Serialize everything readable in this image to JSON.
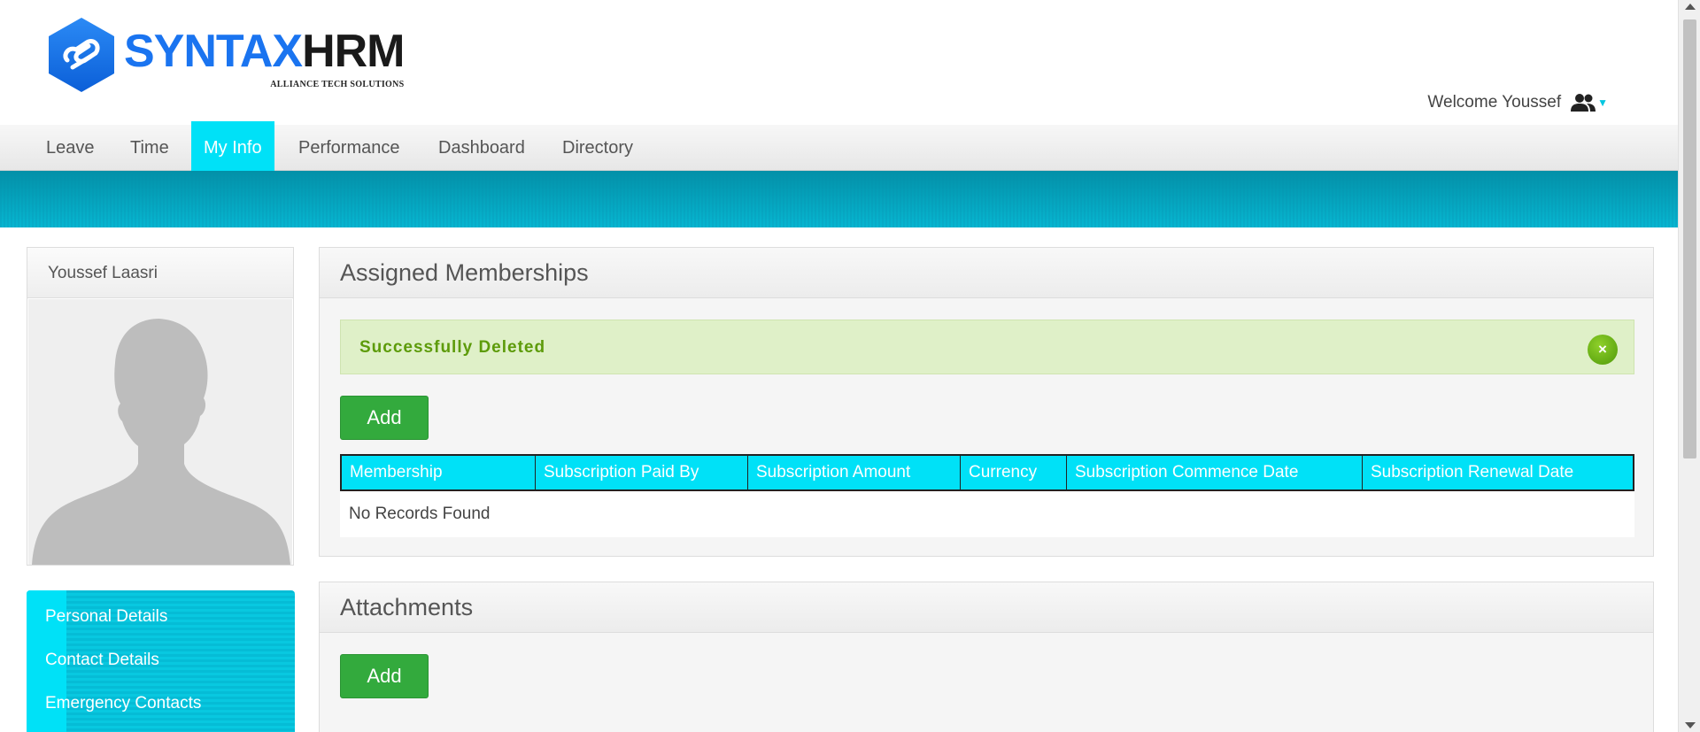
{
  "header": {
    "logo_word_left": "SYNTAX",
    "logo_word_right": "HRM",
    "logo_subtitle": "ALLIANCE TECH SOLUTIONS",
    "welcome_text": "Welcome Youssef",
    "user_icon": "users-icon",
    "dropdown_icon": "caret-down-icon"
  },
  "nav": {
    "items": [
      {
        "label": "Leave",
        "active": false
      },
      {
        "label": "Time",
        "active": false
      },
      {
        "label": "My Info",
        "active": true
      },
      {
        "label": "Performance",
        "active": false
      },
      {
        "label": "Dashboard",
        "active": false
      },
      {
        "label": "Directory",
        "active": false
      }
    ]
  },
  "profile": {
    "name": "Youssef Laasri",
    "photo_icon": "avatar-placeholder-icon"
  },
  "side_menu": {
    "items": [
      {
        "label": "Personal Details"
      },
      {
        "label": "Contact Details"
      },
      {
        "label": "Emergency Contacts"
      }
    ]
  },
  "memberships": {
    "title": "Assigned Memberships",
    "alert": "Successfully Deleted",
    "alert_close": "×",
    "add_label": "Add",
    "columns": [
      "Membership",
      "Subscription Paid By",
      "Subscription Amount",
      "Currency",
      "Subscription Commence Date",
      "Subscription Renewal Date"
    ],
    "empty_text": "No Records Found"
  },
  "attachments": {
    "title": "Attachments",
    "add_label": "Add"
  },
  "colors": {
    "accent_cyan": "#00e1f7",
    "button_green": "#33aa3d",
    "alert_bg": "#dff0c8",
    "alert_text": "#5d9b0a"
  }
}
